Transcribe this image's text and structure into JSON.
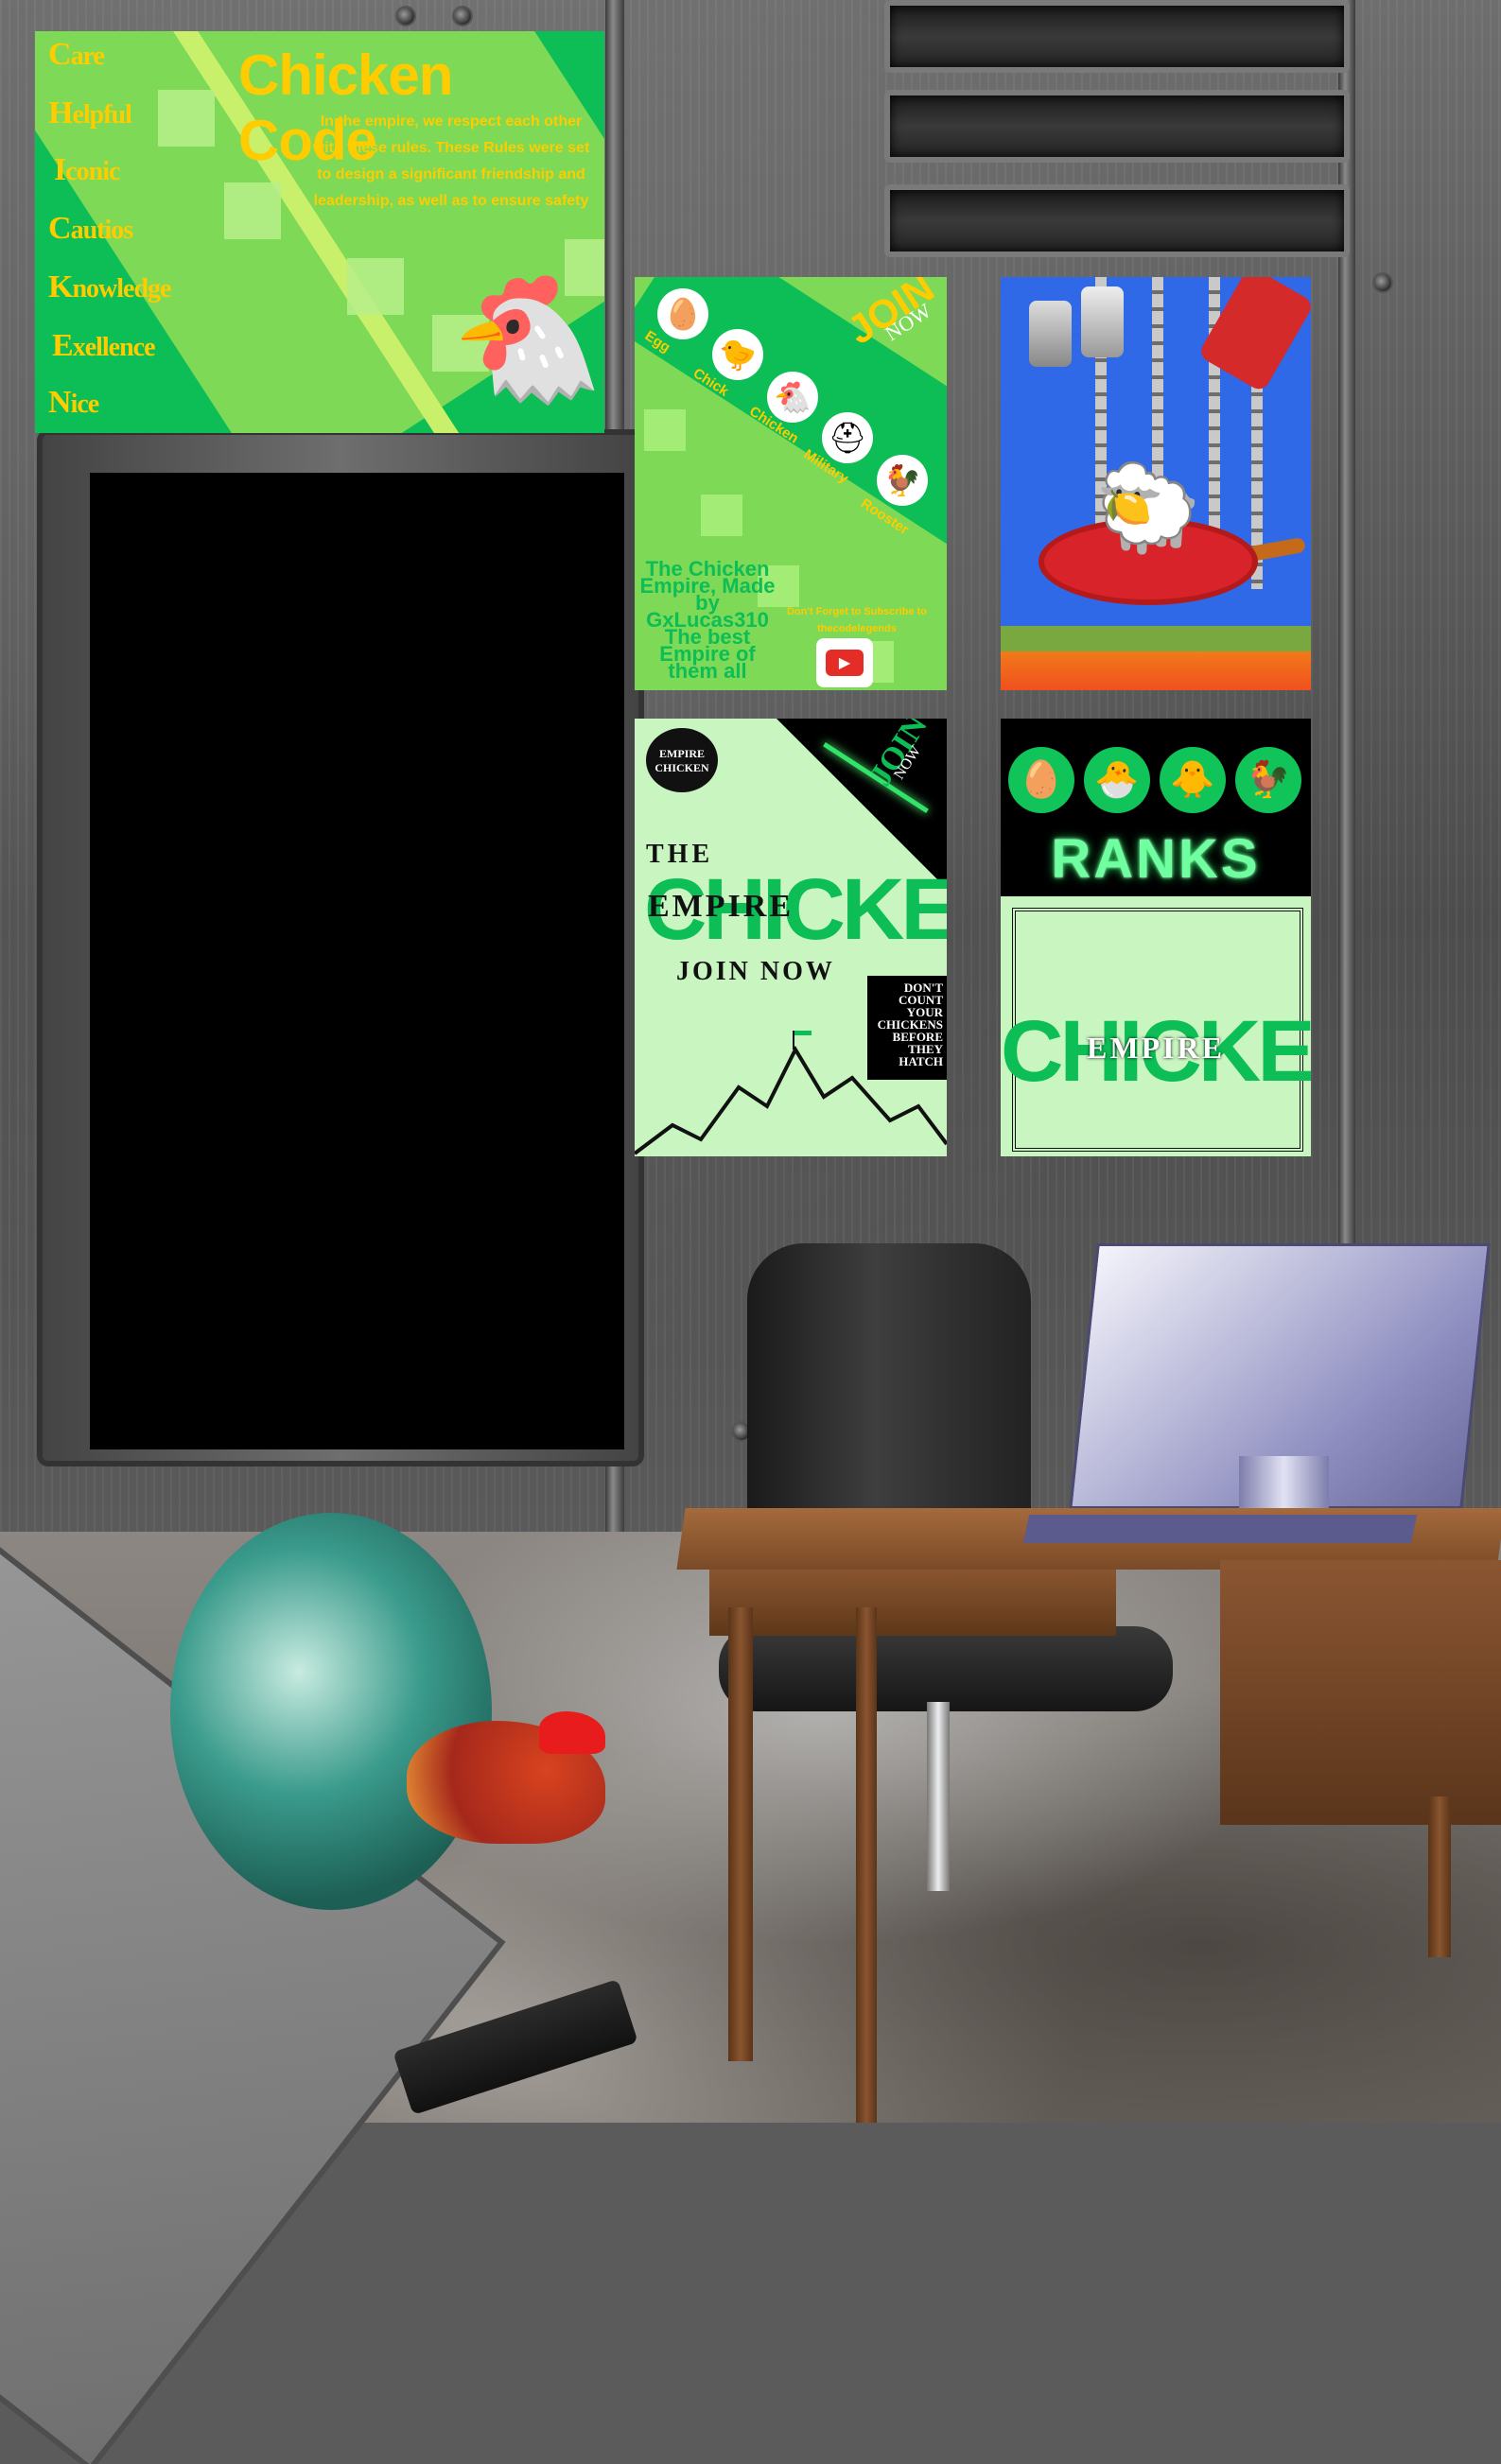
{
  "code_poster": {
    "title": "Chicken Code",
    "body": "In the empire, we respect each other with these rules. These Rules were set to design a significant friendship and leadership, as well as to ensure safety",
    "words": [
      {
        "cap": "C",
        "rest": "are"
      },
      {
        "cap": "H",
        "rest": "elpful"
      },
      {
        "cap": "I",
        "rest": "conic"
      },
      {
        "cap": "C",
        "rest": "autios"
      },
      {
        "cap": "K",
        "rest": "nowledge"
      },
      {
        "cap": "E",
        "rest": "xellence"
      },
      {
        "cap": "N",
        "rest": "ice"
      }
    ]
  },
  "ranks_join_poster": {
    "join": "JOIN",
    "now": "NOW",
    "ranks": [
      {
        "label": "Egg",
        "icon": "egg-icon",
        "glyph": "🥚"
      },
      {
        "label": "Chick",
        "icon": "chick-icon",
        "glyph": "🐤"
      },
      {
        "label": "Chicken",
        "icon": "chicken-icon",
        "glyph": "🐔"
      },
      {
        "label": "Military",
        "icon": "helmet-icon",
        "glyph": "⛑"
      },
      {
        "label": "Rooster",
        "icon": "rooster-icon",
        "glyph": "🐓"
      }
    ],
    "made_by": "The Chicken Empire, Made by GxLucas310 The best Empire of them all",
    "subscribe": "Don't Forget to Subscribe to thecodelegends",
    "play_icon": "youtube-play-icon"
  },
  "empire_poster": {
    "badge": "EMPIRE CHICKEN",
    "join": "JOIN",
    "now": "NOW",
    "the": "THE",
    "chicken": "CHICKEN",
    "empire": "EMPIRE",
    "join_now": "JOIN NOW",
    "slogan": "DON'T COUNT YOUR CHICKENS BEFORE THEY HATCH"
  },
  "ranks_poster": {
    "title": "RANKS",
    "chicken": "CHICKEN",
    "empire": "EMPIRE",
    "icons": [
      "🥚",
      "🐣",
      "🐥",
      "🐓"
    ]
  },
  "colors": {
    "accent_green": "#0dbd55",
    "light_green": "#7ed957",
    "gold": "#ffcc00",
    "pale_green": "#c8f5c0"
  }
}
